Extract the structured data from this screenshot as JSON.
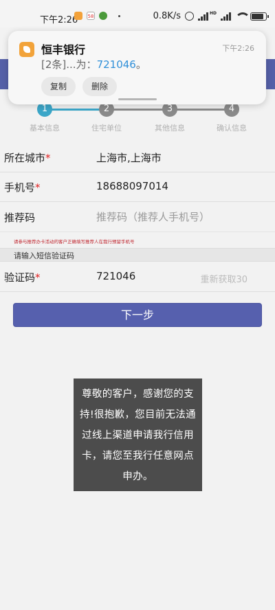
{
  "status_bar": {
    "time": "下午2:26",
    "mini_icon_b": "58",
    "net_speed": "0.8K/s",
    "signal_label": "HD",
    "battery_level_percent": 90
  },
  "notification": {
    "app_name": "恒丰银行",
    "time": "下午2:26",
    "body_prefix": "[2条]...为：",
    "body_code": "721046",
    "body_suffix": "。",
    "copy_label": "复制",
    "delete_label": "删除"
  },
  "steps": {
    "items": [
      {
        "number": "1",
        "label": "基本信息",
        "active": true
      },
      {
        "number": "2",
        "label": "住宅单位",
        "active": false
      },
      {
        "number": "3",
        "label": "其他信息",
        "active": false
      },
      {
        "number": "4",
        "label": "确认信息",
        "active": false
      }
    ],
    "colors": {
      "active": "#3ba6c8",
      "inactive": "#8a8a8a"
    }
  },
  "form": {
    "city": {
      "label": "所在城市",
      "required_mark": "*",
      "value": "上海市,上海市"
    },
    "phone": {
      "label": "手机号",
      "required_mark": "*",
      "value": "18688097014"
    },
    "referral": {
      "label": "推荐码",
      "placeholder": "推荐码（推荐人手机号）"
    },
    "referral_hint": "请参与推荐办卡活动的客户正确填写推荐人在我行预留手机号",
    "sms_section_title": "请输入短信验证码",
    "code": {
      "label": "验证码",
      "required_mark": "*",
      "value": "721046",
      "resend_label": "重新获取30"
    }
  },
  "next_button": {
    "label": "下一步"
  },
  "toast": {
    "message": "尊敬的客户，感谢您的支持!很抱歉，您目前无法通过线上渠道申请我行信用卡，请您至我行任意网点申办。"
  },
  "colors": {
    "brand": "#5660ae",
    "required": "#e02020",
    "hint": "#c0262f",
    "code_highlight": "#2f8fd8",
    "app_icon": "#f2a33a"
  }
}
